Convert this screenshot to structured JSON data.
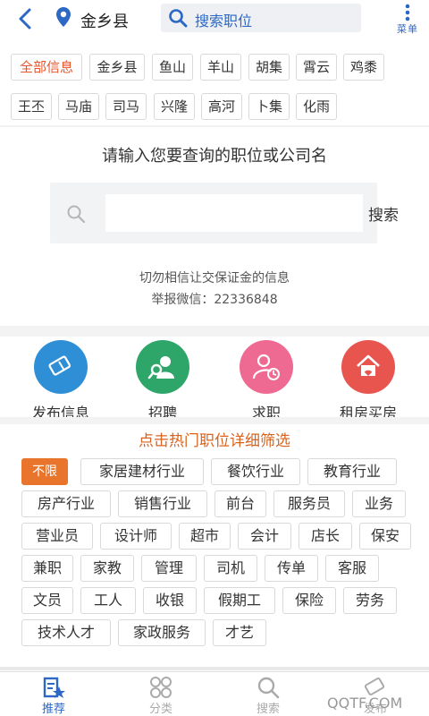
{
  "header": {
    "city": "金乡县",
    "search_placeholder": "搜索职位",
    "menu_label": "菜单"
  },
  "regions": [
    "全部信息",
    "金乡县",
    "鱼山",
    "羊山",
    "胡集",
    "霄云",
    "鸡黍",
    "王丕",
    "马庙",
    "司马",
    "兴隆",
    "高河",
    "卜集",
    "化雨"
  ],
  "search_area": {
    "prompt": "请输入您要查询的职位或公司名",
    "button": "搜索",
    "warning": "切勿相信让交保证金的信息",
    "report": "举报微信：22336848"
  },
  "quick_actions": [
    {
      "label": "发布信息",
      "icon": "edit-icon",
      "color": "#2f8fd6"
    },
    {
      "label": "招聘",
      "icon": "person-search-icon",
      "color": "#2ea66a"
    },
    {
      "label": "求职",
      "icon": "person-clock-icon",
      "color": "#ee6a93"
    },
    {
      "label": "租房买房",
      "icon": "house-icon",
      "color": "#e8554f"
    }
  ],
  "hot_jobs": {
    "title": "点击热门职位详细筛选",
    "tags": [
      "不限",
      "家居建材行业",
      "餐饮行业",
      "教育行业",
      "房产行业",
      "销售行业",
      "前台",
      "服务员",
      "业务",
      "营业员",
      "设计师",
      "超市",
      "会计",
      "店长",
      "保安",
      "兼职",
      "家教",
      "管理",
      "司机",
      "传单",
      "客服",
      "文员",
      "工人",
      "收银",
      "假期工",
      "保险",
      "劳务",
      "技术人才",
      "家政服务",
      "才艺"
    ]
  },
  "bottom_nav": [
    {
      "label": "推荐",
      "icon": "recommend-icon"
    },
    {
      "label": "分类",
      "icon": "category-icon"
    },
    {
      "label": "搜索",
      "icon": "search-icon"
    },
    {
      "label": "发布",
      "icon": "post-icon"
    }
  ],
  "watermark": "QQTF.COM",
  "colors": {
    "accent": "#2d68c4",
    "active_tag": "#e8552b",
    "hot_title": "#d9631e",
    "filter_active_bg": "#e8752b"
  }
}
